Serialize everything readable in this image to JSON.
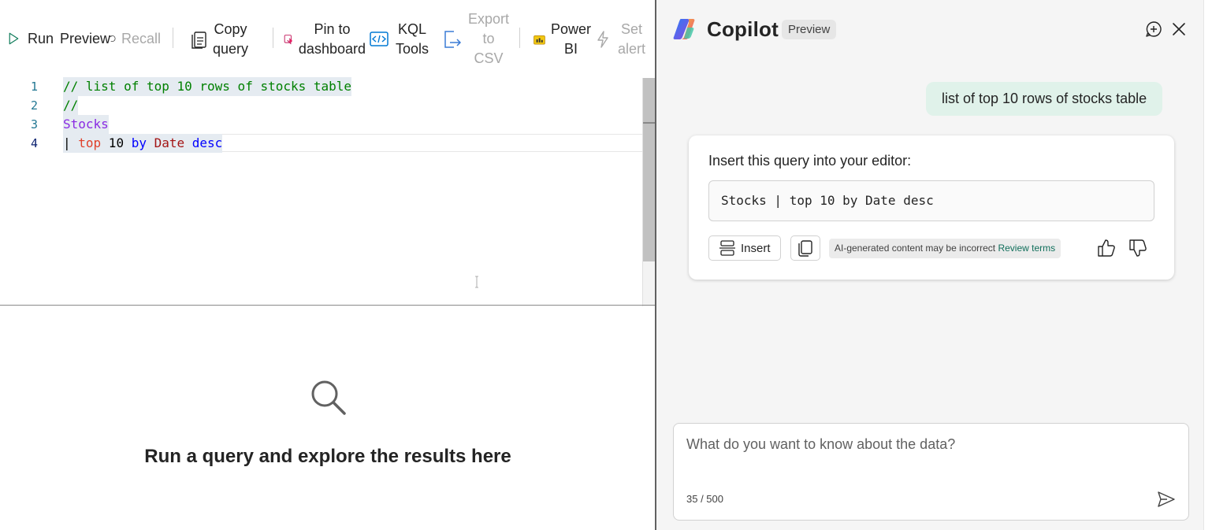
{
  "toolbar": {
    "run": "Run",
    "preview": "Preview",
    "recall": "Recall",
    "copy_query": [
      "Copy",
      "query"
    ],
    "pin_to_dashboard": [
      "Pin to",
      "dashboard"
    ],
    "kql_tools": [
      "KQL",
      "Tools"
    ],
    "export_to_csv": [
      "Export",
      "to",
      "CSV"
    ],
    "power_bi": [
      "Power",
      "BI"
    ],
    "set_alert": [
      "Set",
      "alert"
    ]
  },
  "editor": {
    "line_numbers": [
      "1",
      "2",
      "3",
      "4"
    ],
    "lines": {
      "l1": "// list of top 10 rows of stocks table",
      "l2": "//",
      "l3": "Stocks",
      "l4_pipe": "| ",
      "l4_top": "top",
      "l4_num": " 10 ",
      "l4_by": "by",
      "l4_col": " Date ",
      "l4_desc": "desc"
    }
  },
  "results": {
    "empty_message": "Run a query and explore the results here"
  },
  "copilot": {
    "title": "Copilot",
    "badge": "Preview",
    "user_message": "list of top 10 rows of stocks table",
    "response": {
      "intro": "Insert this query into your editor:",
      "query": "Stocks | top 10 by Date desc",
      "insert_label": "Insert",
      "disclaimer": "AI-generated content may be incorrect",
      "review_terms": "Review terms"
    },
    "input": {
      "placeholder": "What do you want to know about the data?",
      "char_count": "35 / 500"
    }
  },
  "colors": {
    "accent_green": "#0f6e5a",
    "user_bubble": "#e0f2ea",
    "comment": "#008000",
    "keyword": "#e0402a"
  }
}
